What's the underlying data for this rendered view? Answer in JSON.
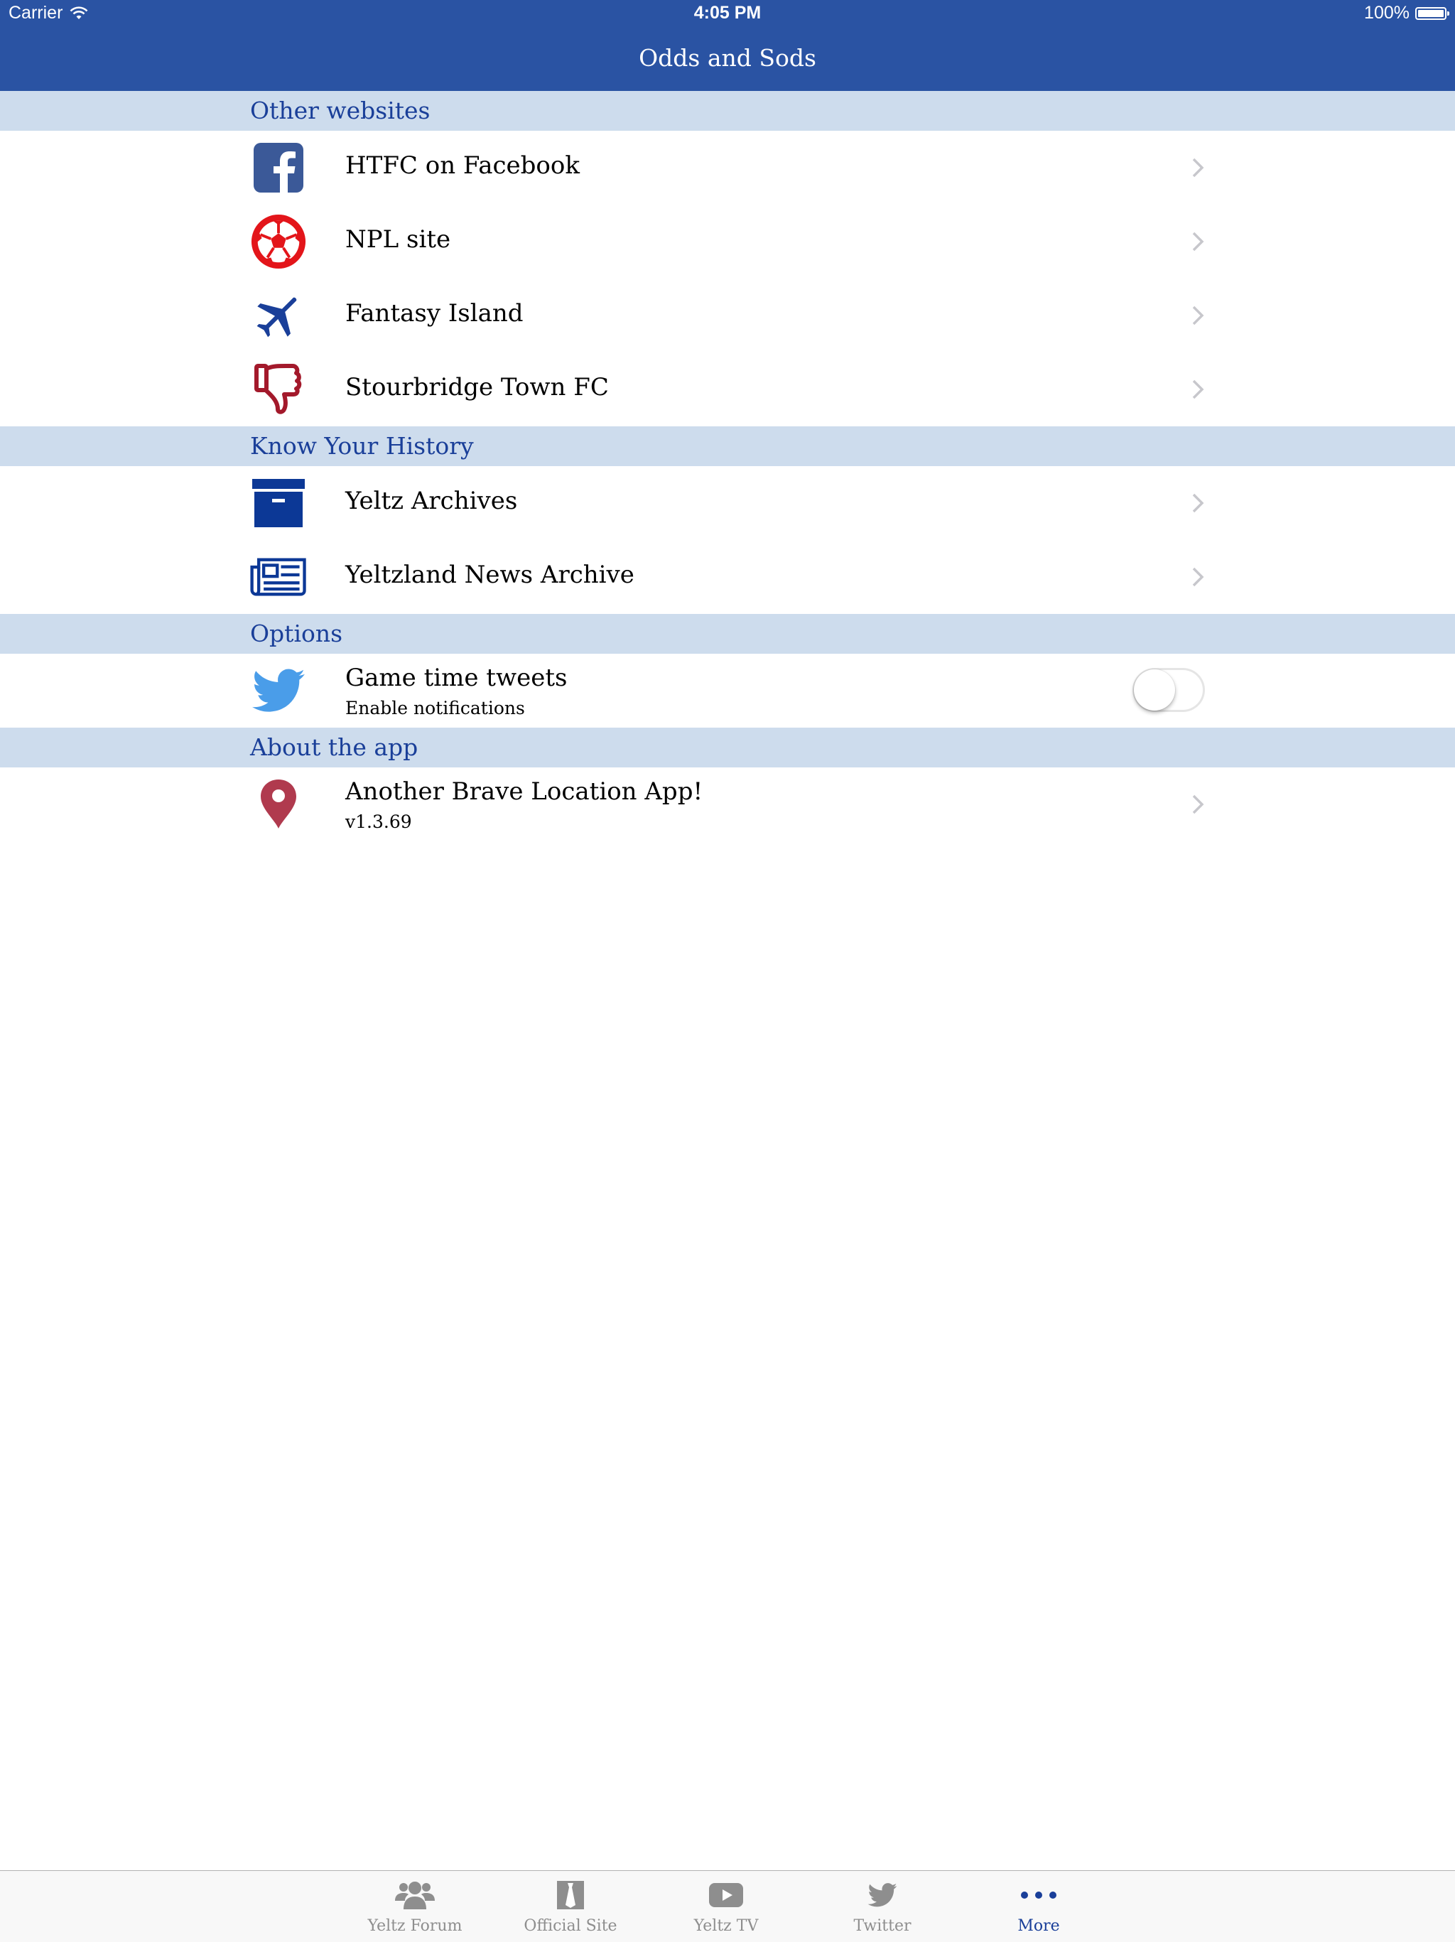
{
  "status_bar": {
    "carrier": "Carrier",
    "time": "4:05 PM",
    "battery": "100%"
  },
  "nav": {
    "title": "Odds and Sods"
  },
  "sections": [
    {
      "header": "Other websites",
      "rows": [
        {
          "label": "HTFC on Facebook",
          "icon": "facebook-icon"
        },
        {
          "label": "NPL site",
          "icon": "soccer-ball-icon"
        },
        {
          "label": "Fantasy Island",
          "icon": "airplane-icon"
        },
        {
          "label": "Stourbridge Town FC",
          "icon": "thumbs-down-icon"
        }
      ]
    },
    {
      "header": "Know Your History",
      "rows": [
        {
          "label": "Yeltz Archives",
          "icon": "archive-box-icon"
        },
        {
          "label": "Yeltzland News Archive",
          "icon": "newspaper-icon"
        }
      ]
    },
    {
      "header": "Options",
      "rows": [
        {
          "label": "Game time tweets",
          "sublabel": "Enable notifications",
          "icon": "twitter-bird-icon",
          "toggle_on": false
        }
      ]
    },
    {
      "header": "About the app",
      "rows": [
        {
          "label": "Another Brave Location App!",
          "sublabel": "v1.3.69",
          "icon": "location-pin-icon"
        }
      ]
    }
  ],
  "tabbar": {
    "tabs": [
      {
        "label": "Yeltz Forum",
        "icon": "group-icon",
        "active": false
      },
      {
        "label": "Official Site",
        "icon": "tie-icon",
        "active": false
      },
      {
        "label": "Yeltz TV",
        "icon": "video-play-icon",
        "active": false
      },
      {
        "label": "Twitter",
        "icon": "twitter-bird-icon",
        "active": false
      },
      {
        "label": "More",
        "icon": "more-dots-icon",
        "active": true
      }
    ]
  },
  "colors": {
    "nav_blue": "#2a53a3",
    "header_bg": "#cddced",
    "header_text": "#1a3f99",
    "accent_red": "#e3151a",
    "pin_red": "#b03a4e",
    "twitter_blue": "#4a9de9",
    "tab_inactive": "#8e8e8e"
  }
}
